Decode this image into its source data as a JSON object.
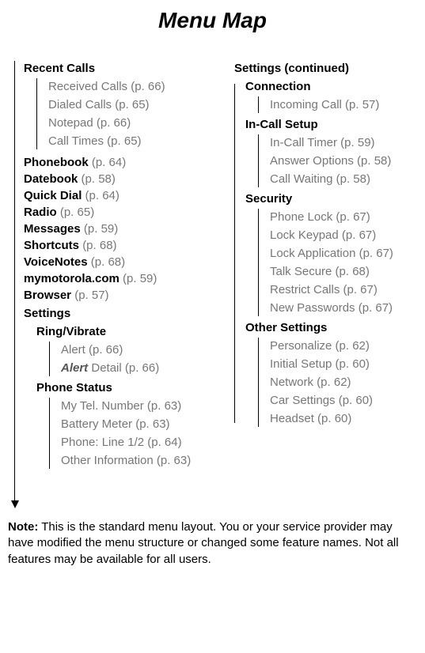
{
  "title": "Menu Map",
  "left": {
    "recent_calls": {
      "heading": "Recent Calls",
      "items": [
        "Received Calls (p. 66)",
        "Dialed Calls (p. 65)",
        "Notepad (p. 66)",
        "Call Times (p. 65)"
      ]
    },
    "entries": [
      {
        "name": "Phonebook",
        "ref": "(p. 64)"
      },
      {
        "name": "Datebook",
        "ref": "(p. 58)"
      },
      {
        "name": "Quick Dial",
        "ref": "(p. 64)"
      },
      {
        "name": "Radio",
        "ref": "(p. 65)"
      },
      {
        "name": "Messages",
        "ref": "(p. 59)"
      },
      {
        "name": "Shortcuts",
        "ref": "(p. 68)"
      },
      {
        "name": "VoiceNotes",
        "ref": "(p. 68)"
      },
      {
        "name": "mymotorola.com",
        "ref": "(p. 59)"
      },
      {
        "name": "Browser",
        "ref": "(p. 57)"
      }
    ],
    "settings_heading": "Settings",
    "ring_vibrate": {
      "heading": "Ring/Vibrate",
      "items": [
        "Alert (p. 66)"
      ],
      "alert_detail_prefix": "Alert",
      "alert_detail_rest": " Detail (p. 66)"
    },
    "phone_status": {
      "heading": "Phone Status",
      "items": [
        "My Tel. Number (p. 63)",
        "Battery Meter (p. 63)",
        "Phone: Line 1/2 (p. 64)",
        "Other Information (p. 63)"
      ]
    }
  },
  "right": {
    "heading": "Settings (continued)",
    "connection": {
      "heading": "Connection",
      "items": [
        "Incoming Call (p. 57)"
      ]
    },
    "in_call_setup": {
      "heading": "In-Call Setup",
      "items": [
        "In-Call Timer (p. 59)",
        "Answer Options (p. 58)",
        "Call Waiting (p. 58)"
      ]
    },
    "security": {
      "heading": "Security",
      "items": [
        "Phone Lock (p. 67)",
        "Lock Keypad (p. 67)",
        "Lock Application (p. 67)",
        "Talk Secure (p. 68)",
        "Restrict Calls (p. 67)",
        "New Passwords (p. 67)"
      ]
    },
    "other_settings": {
      "heading": "Other Settings",
      "items": [
        "Personalize (p. 62)",
        "Initial Setup (p. 60)",
        "Network (p. 62)",
        "Car Settings (p. 60)",
        "Headset (p. 60)"
      ]
    }
  },
  "note": {
    "label": "Note:",
    "text": " This is the standard menu layout. You or your service provider may have modified the menu structure or changed some feature names. Not all features may be available for all users."
  }
}
